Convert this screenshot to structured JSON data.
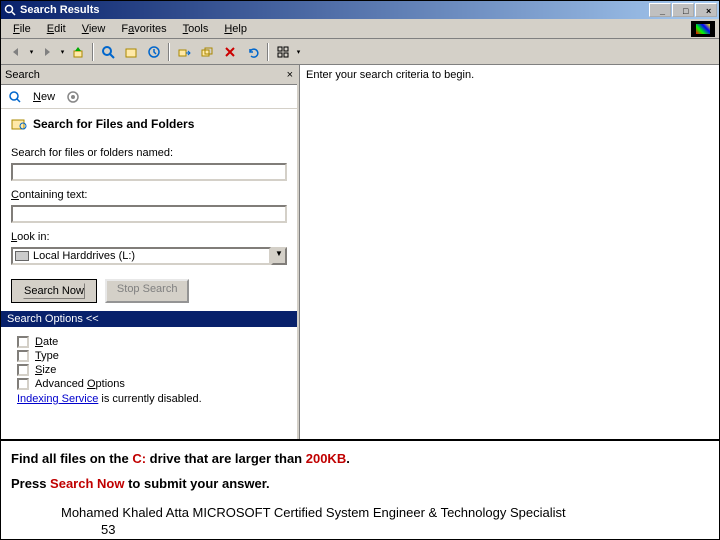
{
  "titlebar": {
    "title": "Search Results"
  },
  "menu": {
    "file": "File",
    "edit": "Edit",
    "view": "View",
    "favorites": "Favorites",
    "tools": "Tools",
    "help": "Help"
  },
  "search_panel": {
    "header": "Search",
    "new": "New",
    "form_title": "Search for Files and Folders",
    "label_name": "Search for files or folders named:",
    "value_name": "",
    "label_containing": "Containing text:",
    "value_containing": "",
    "label_lookin": "Look in:",
    "lookin_value": "Local Harddrives (L:)",
    "btn_search": "Search Now",
    "btn_stop": "Stop Search",
    "options_header": "Search Options <<",
    "chk_date": "Date",
    "chk_type": "Type",
    "chk_size": "Size",
    "chk_advanced": "Advanced Options",
    "indexing_link": "Indexing Service",
    "indexing_rest": " is currently disabled."
  },
  "results": {
    "prompt": "Enter your search criteria to begin."
  },
  "instruction": {
    "line1a": "Find all files on the ",
    "line1b": "C:",
    "line1c": " drive that are larger than ",
    "line1d": "200KB",
    "line1e": ".",
    "line2a": "Press ",
    "line2b": "Search Now",
    "line2c": " to submit your answer."
  },
  "footer": {
    "credit": "Mohamed Khaled Atta MICROSOFT Certified System Engineer & Technology Specialist",
    "page": "53"
  }
}
